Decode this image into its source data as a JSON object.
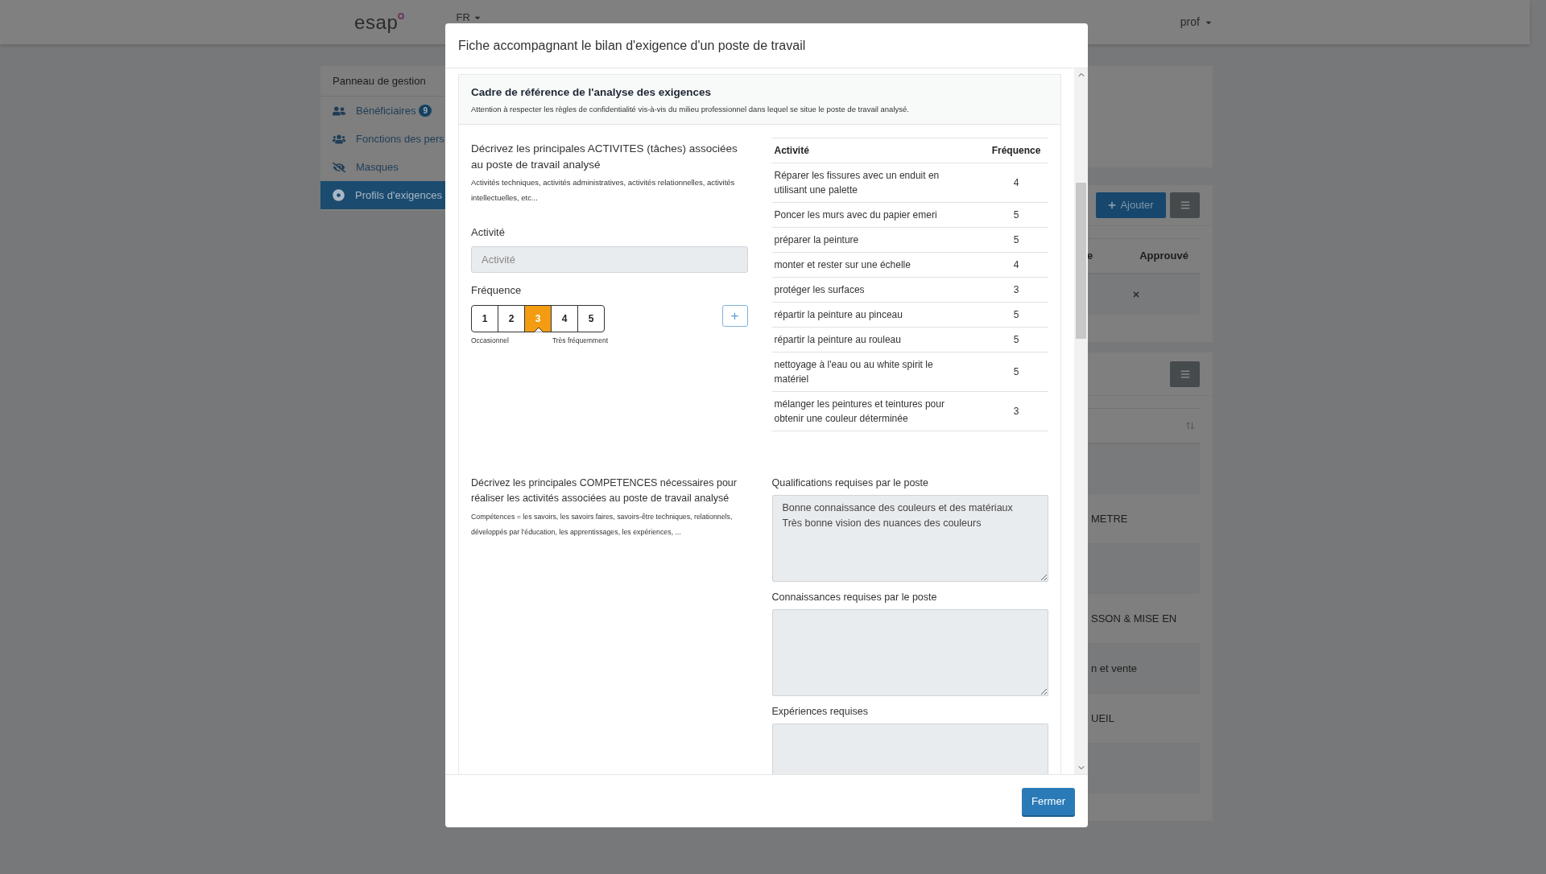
{
  "navbar": {
    "logo": "esap",
    "language": "FR",
    "user": "prof"
  },
  "sidebar": {
    "title": "Panneau de gestion",
    "items": [
      {
        "label": "Bénéficiaires",
        "badge": "9",
        "selected": false
      },
      {
        "label": "Fonctions des pers",
        "selected": false
      },
      {
        "label": "Masques",
        "selected": false
      },
      {
        "label": "Profils d'exigences",
        "selected": true
      }
    ]
  },
  "background_cards": {
    "add_button": "Ajouter",
    "table_1": {
      "column_1": "e",
      "column_2": "Approuvé",
      "rows": [
        {
          "approved": false
        }
      ]
    },
    "table_2": {
      "rows": [
        {},
        {
          "text": "METRE"
        },
        {},
        {
          "text": "SSON & MISE EN"
        },
        {
          "text": "n et vente"
        },
        {
          "text": "UEIL"
        },
        {}
      ]
    }
  },
  "modal": {
    "title": "Fiche accompagnant le bilan d'exigence d'un poste de travail",
    "card": {
      "title": "Cadre de référence de l'analyse des exigences",
      "subtitle": "Attention à respecter les règles de confidentialité vis-à-vis du milieu professionnel dans lequel se situe le poste de travail analysé."
    },
    "activities": {
      "description": "Décrivez les principales ACTIVITES (tâches) associées au poste de travail analysé",
      "hint": "Activités techniques, activités administratives, activités relationnelles, activités intellectuelles, etc...",
      "activity_label": "Activité",
      "activity_placeholder": "Activité",
      "frequency_label": "Fréquence",
      "frequency_options": [
        {
          "label": "1",
          "selected": false
        },
        {
          "label": "2",
          "selected": false
        },
        {
          "label": "3",
          "selected": true
        },
        {
          "label": "4",
          "selected": false
        },
        {
          "label": "5",
          "selected": false
        }
      ],
      "scale_min": "Occasionnel",
      "scale_max": "Très fréquemment",
      "add_symbol": "+"
    },
    "table": {
      "columns": [
        "Activité",
        "Fréquence"
      ],
      "rows": [
        [
          "Réparer les fissures avec un enduit en utilisant une palette",
          "4"
        ],
        [
          "Poncer les murs avec du papier emeri",
          "5"
        ],
        [
          "préparer la peinture",
          "5"
        ],
        [
          "monter et rester sur une échelle",
          "4"
        ],
        [
          "protéger les surfaces",
          "3"
        ],
        [
          "répartir la peinture au pinceau",
          "5"
        ],
        [
          "répartir la peinture au rouleau",
          "5"
        ],
        [
          "nettoyage à l'eau ou au white spirit le matériel",
          "5"
        ],
        [
          "mélanger les peintures et teintures pour obtenir une couleur déterminée",
          "3"
        ]
      ]
    },
    "competences": {
      "description": "Décrivez les principales COMPETENCES nécessaires pour réaliser les activités associées au poste de travail analysé",
      "hint": "Compétences = les savoirs, les savoirs faires, savoirs-être techniques, relationnels, développés par l'éducation, les apprentissages, les expériences, ..."
    },
    "fields": [
      {
        "label": "Qualifications requises par le poste",
        "value": "Bonne connaissance des couleurs et des matériaux\nTrès bonne vision des nuances des couleurs"
      },
      {
        "label": "Connaissances requises par le poste"
      },
      {
        "label": "Expériences requises"
      }
    ],
    "close_button": "Fermer"
  }
}
